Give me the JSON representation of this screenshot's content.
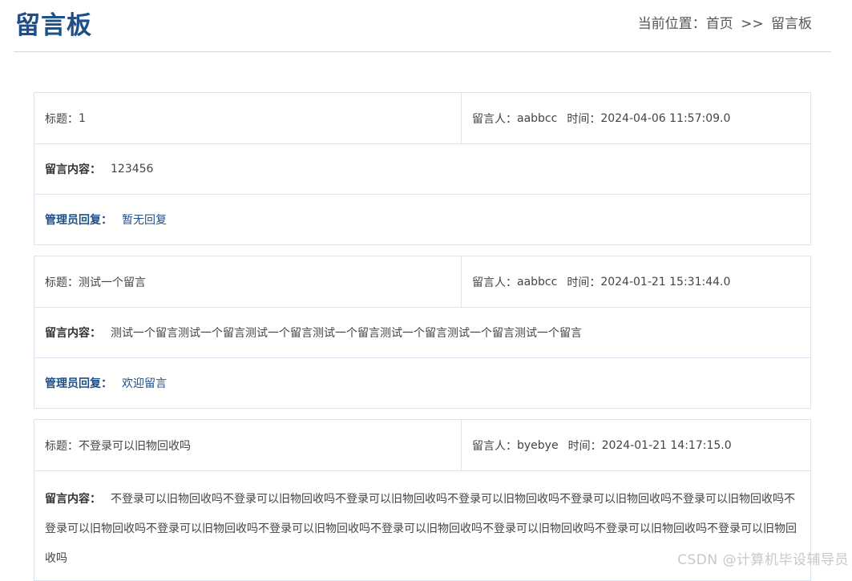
{
  "header": {
    "title": "留言板",
    "breadcrumb": {
      "prefix": "当前位置：",
      "home": "首页",
      "separator": ">>",
      "current": "留言板"
    }
  },
  "labels": {
    "title": "标题：",
    "author": "留言人：",
    "time": "时间：",
    "content": "留言内容：",
    "reply": "管理员回复："
  },
  "messages": [
    {
      "title": "1",
      "author": "aabbcc",
      "time": "2024-04-06 11:57:09.0",
      "content": "123456",
      "reply": "暂无回复"
    },
    {
      "title": "测试一个留言",
      "author": "aabbcc",
      "time": "2024-01-21 15:31:44.0",
      "content": "测试一个留言测试一个留言测试一个留言测试一个留言测试一个留言测试一个留言测试一个留言",
      "reply": "欢迎留言"
    },
    {
      "title": "不登录可以旧物回收吗",
      "author": "byebye",
      "time": "2024-01-21 14:17:15.0",
      "content": "不登录可以旧物回收吗不登录可以旧物回收吗不登录可以旧物回收吗不登录可以旧物回收吗不登录可以旧物回收吗不登录可以旧物回收吗不登录可以旧物回收吗不登录可以旧物回收吗不登录可以旧物回收吗不登录可以旧物回收吗不登录可以旧物回收吗不登录可以旧物回收吗不登录可以旧物回收吗"
    }
  ],
  "watermark": "CSDN @计算机毕设辅导员"
}
